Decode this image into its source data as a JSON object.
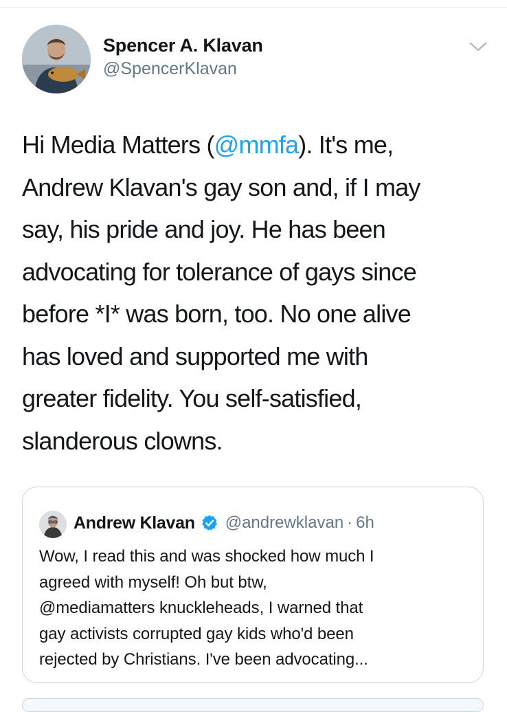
{
  "tweet": {
    "author": {
      "name": "Spencer A. Klavan",
      "handle": "@SpencerKlavan"
    },
    "text_lines": [
      {
        "before": "Hi Media Matters (",
        "mention": "@mmfa",
        "after": "). It's me,"
      },
      "Andrew Klavan's gay son and, if I may",
      "say, his pride and joy. He has been",
      "advocating for tolerance of gays since",
      "before *I* was born, too. No one alive",
      "has loved and supported me with",
      "greater fidelity. You self-satisfied,",
      "slanderous clowns."
    ]
  },
  "quoted_tweet": {
    "author": {
      "name": "Andrew Klavan",
      "handle": "@andrewklavan",
      "verified": true
    },
    "separator": "·",
    "time": "6h",
    "text_lines": [
      "Wow, I read this and was shocked how much I",
      "agreed with myself! Oh but btw,",
      "@mediamatters knuckleheads, I warned that",
      "gay activists corrupted gay kids who'd been",
      "rejected by Christians. I've been advocating..."
    ]
  },
  "colors": {
    "link": "#1da1f2",
    "secondary_text": "#657786",
    "border": "#ccd6dd",
    "verified_badge": "#1da1f2"
  },
  "icons": {
    "caret": "chevron-down-icon",
    "verified": "verified-badge-icon"
  }
}
